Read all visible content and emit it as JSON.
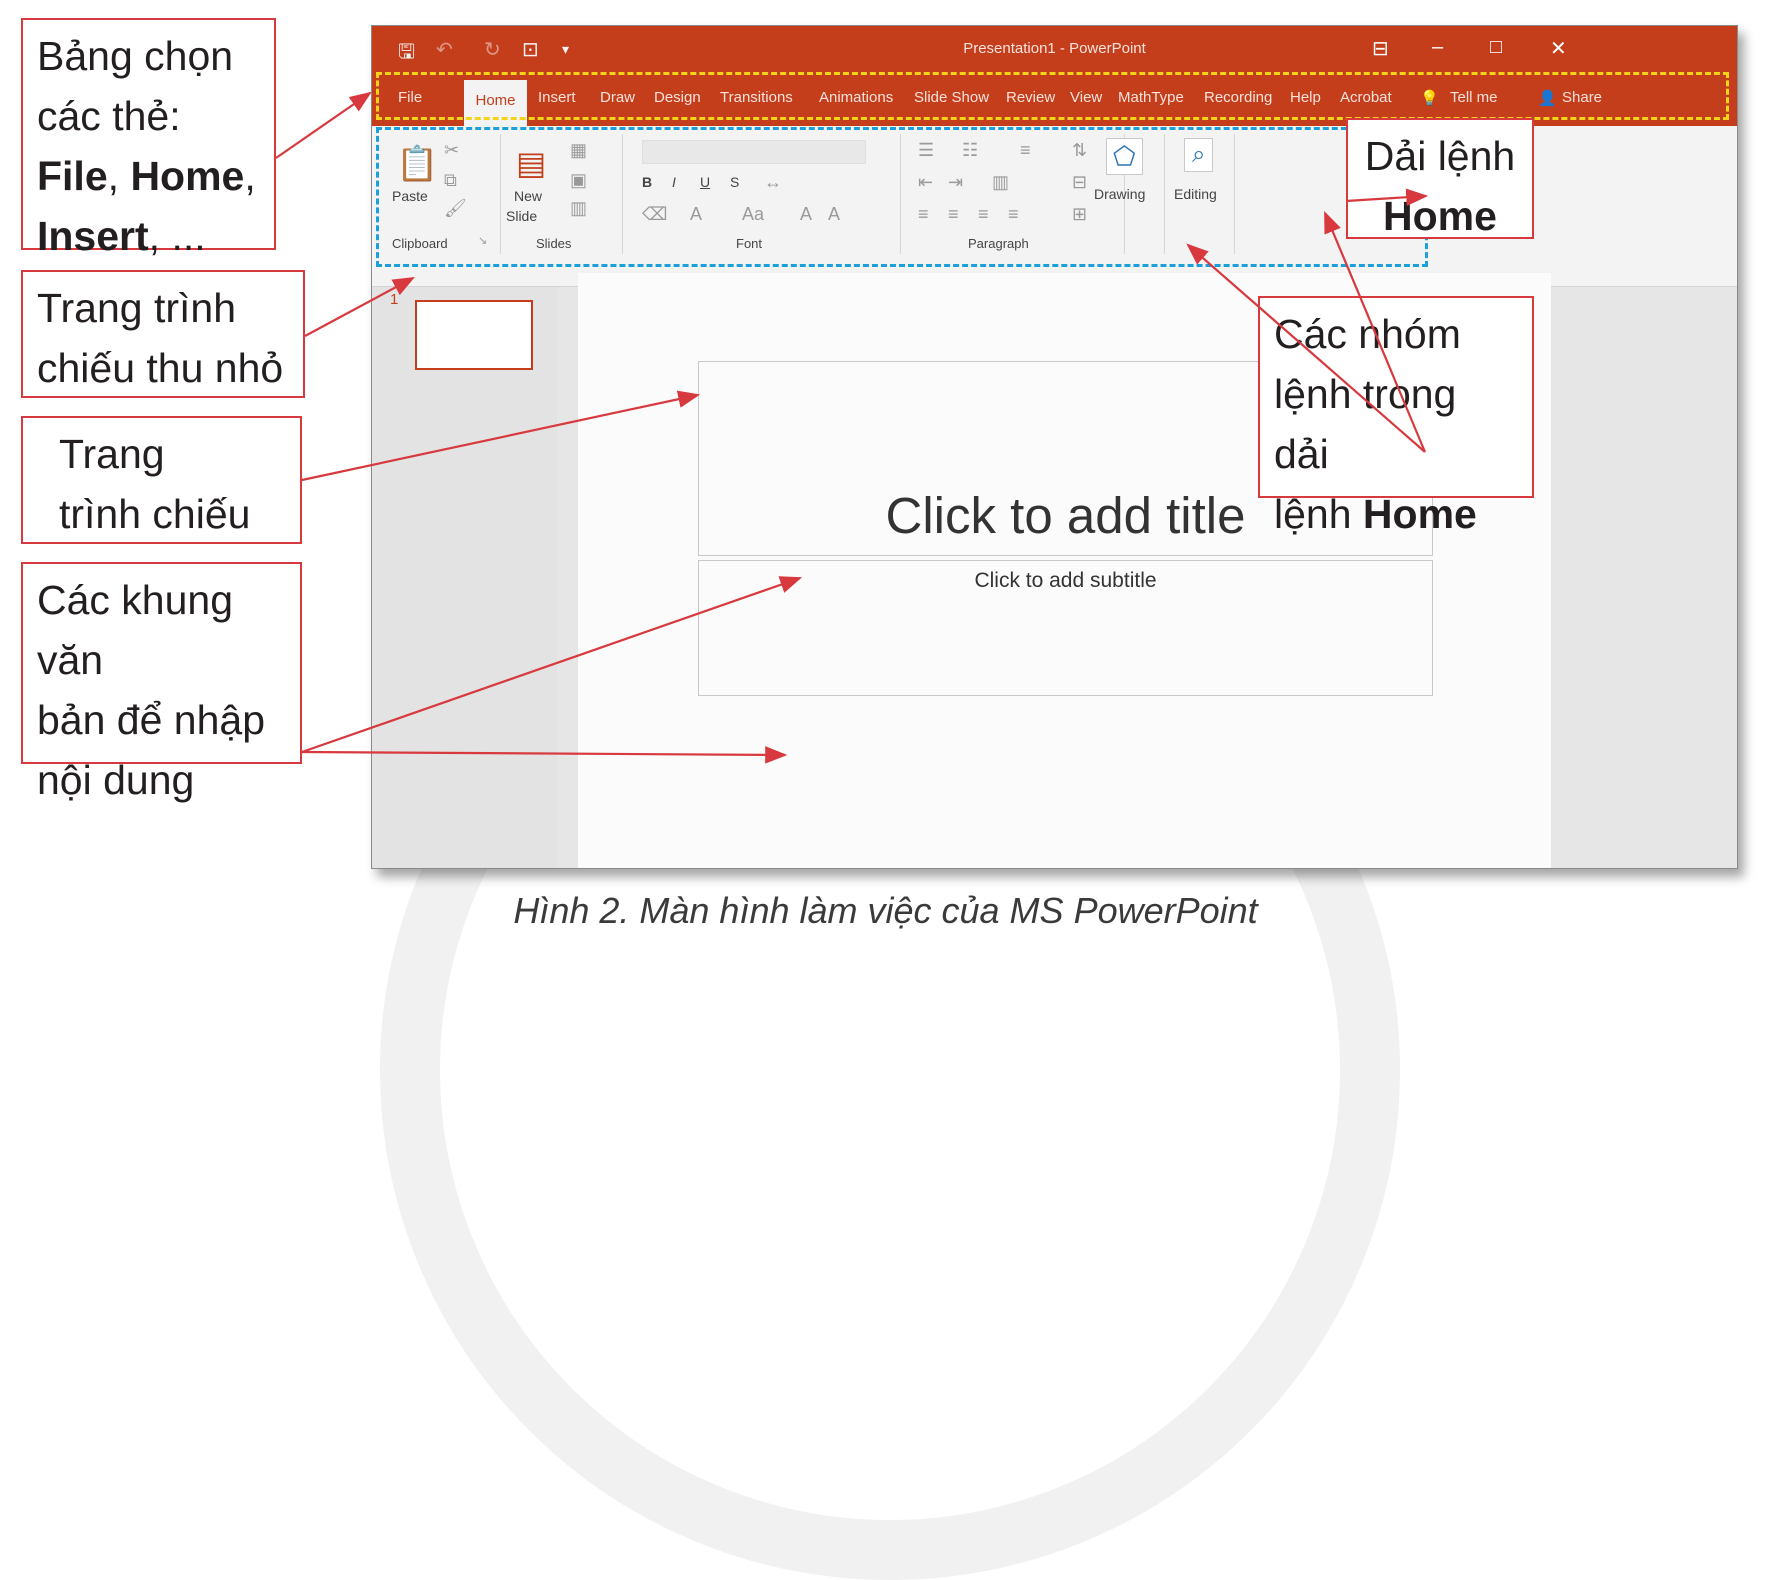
{
  "window": {
    "title": "Presentation1 - PowerPoint",
    "tabs": [
      "File",
      "Home",
      "Insert",
      "Draw",
      "Design",
      "Transitions",
      "Animations",
      "Slide Show",
      "Review",
      "View",
      "MathType",
      "Recording",
      "Help",
      "Acrobat",
      "Tell me",
      "Share"
    ],
    "active_tab": "Home",
    "ribbon": {
      "clipboard": {
        "paste": "Paste",
        "group": "Clipboard"
      },
      "slides": {
        "new_slide_1": "New",
        "new_slide_2": "Slide",
        "group": "Slides"
      },
      "font": {
        "bold": "B",
        "italic": "I",
        "underline": "U",
        "strike": "S",
        "group": "Font"
      },
      "paragraph": {
        "group": "Paragraph"
      },
      "drawing": "Drawing",
      "editing": "Editing"
    },
    "thumbnail_number": "1",
    "slide": {
      "title_placeholder": "Click to add title",
      "subtitle_placeholder": "Click to add subtitle"
    }
  },
  "annotations": {
    "tabs_note": {
      "line1": "Bảng chọn",
      "line2": "các thẻ:",
      "b1": "File",
      "sep": ", ",
      "b2": "Home",
      "comma": ",",
      "b3": "Insert",
      "tail": ", ..."
    },
    "ribbon_note": {
      "line1": "Dải lệnh",
      "bold": "Home"
    },
    "thumbnail_note": {
      "line1": "Trang trình",
      "line2": "chiếu thu nhỏ"
    },
    "slide_note": {
      "line1": "Trang",
      "line2": "trình chiếu"
    },
    "textbox_note": {
      "line1": "Các khung văn",
      "line2": "bản để nhập",
      "line3": "nội dung"
    },
    "groups_note": {
      "line1": "Các nhóm",
      "line2": "lệnh trong dải",
      "line3": "lệnh ",
      "bold": "Home"
    }
  },
  "caption": "Hình 2. Màn hình làm việc của MS PowerPoint",
  "colors": {
    "accent": "#c43e1c",
    "annotation_border": "#d7393e",
    "tabs_highlight": "#f5d319",
    "ribbon_highlight": "#1ba0dc"
  }
}
